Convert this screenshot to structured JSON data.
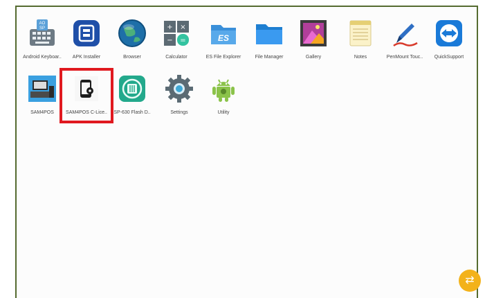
{
  "apps": [
    {
      "label": "Android Keyboar..",
      "icon": "aosp-keyboard-icon"
    },
    {
      "label": "APK Installer",
      "icon": "apk-installer-icon"
    },
    {
      "label": "Browser",
      "icon": "browser-globe-icon"
    },
    {
      "label": "Calculator",
      "icon": "calculator-icon"
    },
    {
      "label": "ES File Explorer",
      "icon": "es-file-explorer-icon"
    },
    {
      "label": "File Manager",
      "icon": "folder-icon"
    },
    {
      "label": "Gallery",
      "icon": "gallery-icon"
    },
    {
      "label": "Notes",
      "icon": "notes-icon"
    },
    {
      "label": "PenMount Touc..",
      "icon": "pen-icon"
    },
    {
      "label": "QuickSupport",
      "icon": "teamviewer-icon"
    },
    {
      "label": "SAM4POS",
      "icon": "pos-terminal-icon"
    },
    {
      "label": "SAM4POS C-Lice..",
      "icon": "phone-settings-icon"
    },
    {
      "label": "SP-630 Flash D..",
      "icon": "flash-drive-icon"
    },
    {
      "label": "Settings",
      "icon": "gear-icon"
    },
    {
      "label": "Utility",
      "icon": "android-robot-icon"
    }
  ],
  "colors": {
    "highlight": "#e0191f",
    "frame": "#556b2f",
    "fab": "#f3b21a"
  },
  "fab": {
    "icon": "swap-arrows-icon"
  }
}
